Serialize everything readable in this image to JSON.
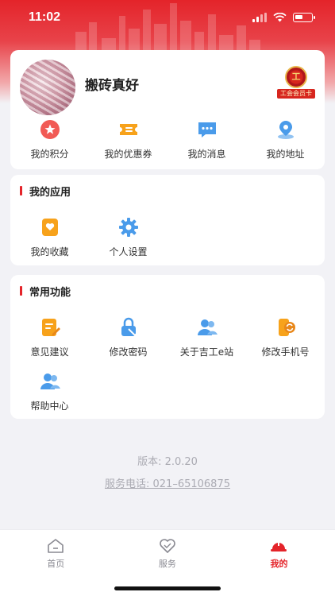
{
  "status_bar": {
    "time": "11:02"
  },
  "profile": {
    "username": "搬砖真好",
    "member_card_label": "工会会员卡",
    "member_card_mark": "工",
    "shortcuts": [
      {
        "label": "我的积分",
        "icon": "points-icon"
      },
      {
        "label": "我的优惠券",
        "icon": "coupon-icon"
      },
      {
        "label": "我的消息",
        "icon": "message-icon"
      },
      {
        "label": "我的地址",
        "icon": "location-icon"
      }
    ]
  },
  "my_apps": {
    "title": "我的应用",
    "items": [
      {
        "label": "我的收藏",
        "icon": "favorites-icon"
      },
      {
        "label": "个人设置",
        "icon": "settings-gear-icon"
      }
    ]
  },
  "common_functions": {
    "title": "常用功能",
    "items": [
      {
        "label": "意见建议",
        "icon": "feedback-icon"
      },
      {
        "label": "修改密码",
        "icon": "password-lock-icon"
      },
      {
        "label": "关于吉工e站",
        "icon": "about-users-icon"
      },
      {
        "label": "修改手机号",
        "icon": "phone-change-icon"
      },
      {
        "label": "帮助中心",
        "icon": "help-users-icon"
      }
    ]
  },
  "footer": {
    "version": "版本: 2.0.20",
    "service_phone": "服务电话: 021–65106875"
  },
  "tabbar": {
    "tabs": [
      {
        "label": "首页",
        "icon": "home-icon",
        "active": false
      },
      {
        "label": "服务",
        "icon": "heart-icon",
        "active": false
      },
      {
        "label": "我的",
        "icon": "helmet-icon",
        "active": true
      }
    ]
  },
  "colors": {
    "brand_red": "#E4242A",
    "page_bg": "#F2F2F6",
    "muted_text": "#ABABB3"
  }
}
